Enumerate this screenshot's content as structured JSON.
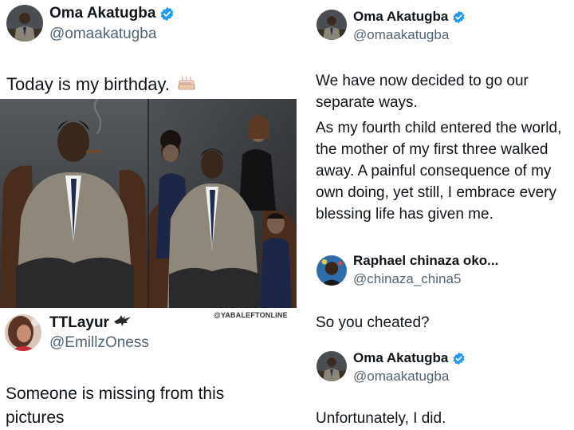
{
  "left": {
    "post": {
      "author_name": "Oma Akatugba",
      "author_handle": "@omaakatugba",
      "text": "Today is my birthday.",
      "emoji_icon": "birthday-cake-icon",
      "verified_color": "#1d9bf0"
    },
    "photo_watermark": "@YABALEFTONLINE",
    "reply": {
      "author_name": "TTLayur",
      "author_handle": "@EmillzOness",
      "text": "Someone is missing from this pictures",
      "name_icon": "eagle-icon"
    }
  },
  "right": {
    "post": {
      "author_name": "Oma Akatugba",
      "author_handle": "@omaakatugba",
      "text_p1": "We have now decided to go our separate ways.",
      "text_p2": "As my fourth child entered the world, the mother of my first three walked away. A painful consequence of my own doing, yet still, I embrace every blessing life has given me."
    },
    "reply": {
      "author_name": "Raphael chinaza oko...",
      "author_handle": "@chinaza_china5",
      "text": "So you cheated?"
    },
    "answer": {
      "author_name": "Oma Akatugba",
      "author_handle": "@omaakatugba",
      "text": "Unfortunately, I did."
    }
  },
  "colors": {
    "text": "#0f1419",
    "secondary": "#536471",
    "verified": "#1d9bf0"
  }
}
